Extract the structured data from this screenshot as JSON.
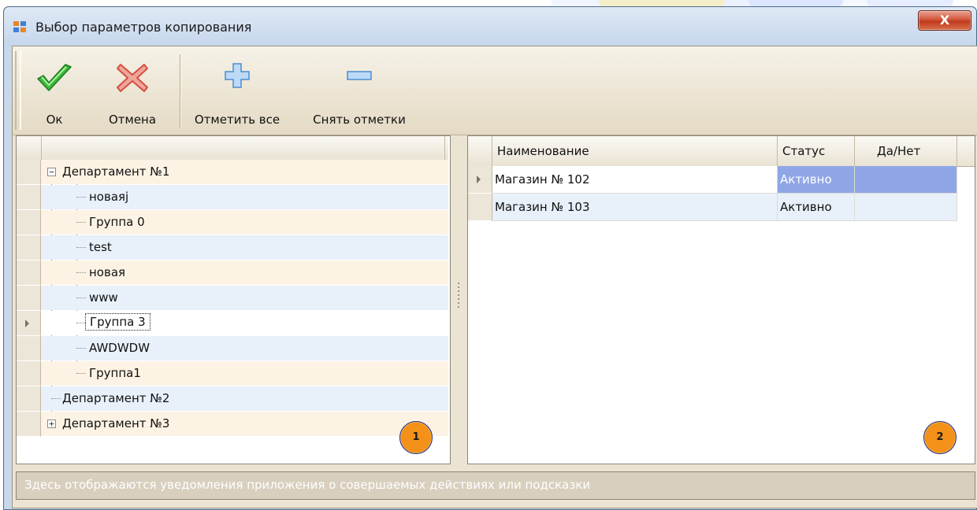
{
  "window": {
    "title": "Выбор параметров копирования",
    "close_label": "X"
  },
  "toolbar": {
    "ok_label": "Ок",
    "cancel_label": "Отмена",
    "check_all_label": "Отметить все",
    "uncheck_label": "Снять отметки"
  },
  "tree": {
    "items": [
      {
        "label": "Департамент №1",
        "level": 0,
        "expander": "−"
      },
      {
        "label": "новаяj",
        "level": 1
      },
      {
        "label": "Группа 0",
        "level": 1
      },
      {
        "label": "test",
        "level": 1
      },
      {
        "label": "новая",
        "level": 1
      },
      {
        "label": "www",
        "level": 1
      },
      {
        "label": "Группа 3",
        "level": 1,
        "focused": true
      },
      {
        "label": "AWDWDW",
        "level": 1
      },
      {
        "label": "Группа1",
        "level": 1
      },
      {
        "label": "Департамент №2",
        "level": 0
      },
      {
        "label": "Департамент №3",
        "level": 0,
        "expander": "+"
      }
    ]
  },
  "grid": {
    "columns": [
      "Наименование",
      "Статус",
      "Да/Нет"
    ],
    "rows": [
      {
        "name": "Магазин № 102",
        "status": "Активно",
        "yes_no": ""
      },
      {
        "name": "Магазин № 103",
        "status": "Активно",
        "yes_no": ""
      }
    ]
  },
  "callouts": {
    "left": "1",
    "right": "2"
  },
  "status_bar": {
    "text": "Здесь отображаются уведомления приложения о совершаемых действиях или подсказки"
  },
  "colors": {
    "row_even": "#fdf3e4",
    "row_odd": "#e8f1fa",
    "selected_cell": "#8fa6e6",
    "callout": "#f39118"
  }
}
